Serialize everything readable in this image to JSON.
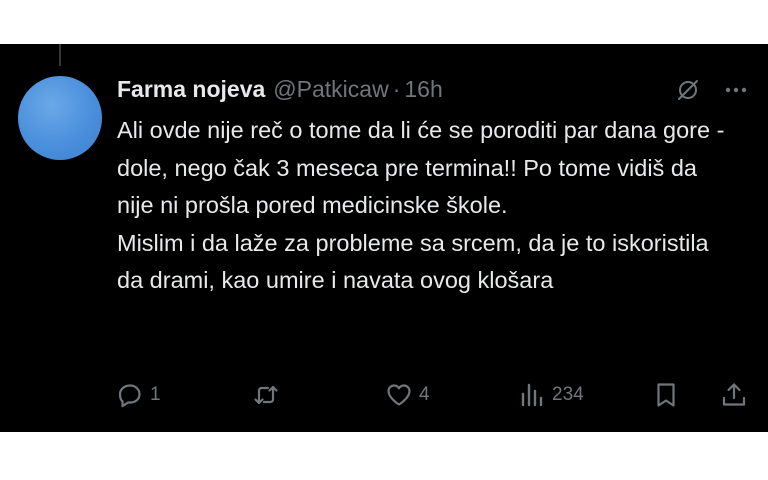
{
  "tweet": {
    "author_name": "Farma nojeva",
    "handle": "@Patkicaw",
    "separator": "·",
    "time": "16h",
    "text_paragraphs": [
      "Ali ovde nije reč o tome da li će se poroditi par dana gore - dole, nego čak 3 meseca pre termina!! Po tome vidiš da nije ni prošla pored medicinske škole.",
      "Mislim i da laže za probleme sa srcem, da je to iskoristila da drami, kao umire i navata ovog klošara"
    ]
  },
  "actions": {
    "replies": "1",
    "reposts": "",
    "likes": "4",
    "views": "234"
  },
  "icons": {
    "header": [
      "grok-icon",
      "more-icon"
    ],
    "actions": [
      "reply-icon",
      "repost-icon",
      "like-icon",
      "views-icon",
      "bookmark-icon",
      "share-icon"
    ]
  },
  "colors": {
    "background": "#000000",
    "text_primary": "#e7e9ea",
    "text_secondary": "#71767b",
    "avatar": "#4a8fdc"
  }
}
